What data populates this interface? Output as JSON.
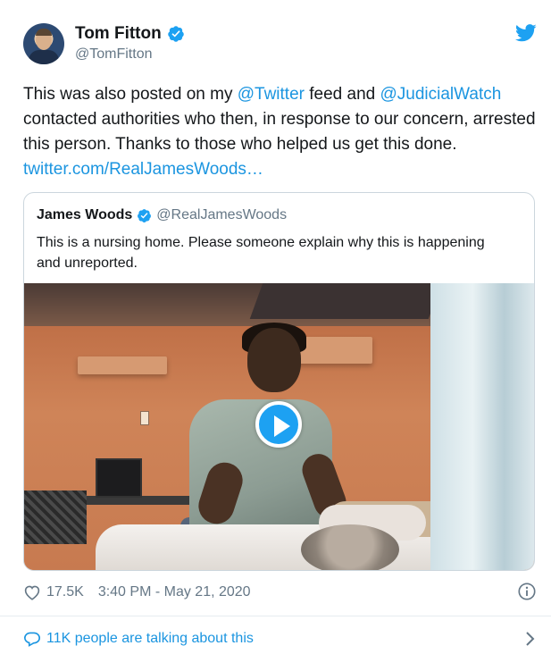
{
  "author": {
    "display_name": "Tom Fitton",
    "handle": "@TomFitton",
    "verified": true
  },
  "tweet": {
    "segments": [
      {
        "text": "This was also posted on my ",
        "link": false
      },
      {
        "text": "@Twitter",
        "link": true
      },
      {
        "text": " feed and ",
        "link": false
      },
      {
        "text": "@JudicialWatch",
        "link": true
      },
      {
        "text": " contacted authorities who then, in response to our concern, arrested this person. Thanks to those who helped us get this done. ",
        "link": false
      },
      {
        "text": "twitter.com/RealJamesWoods…",
        "link": true
      }
    ]
  },
  "quoted_tweet": {
    "display_name": "James Woods",
    "handle": "@RealJamesWoods",
    "verified": true,
    "text": "This is a nursing home. Please someone explain why this is happening and unreported."
  },
  "footer": {
    "likes": "17.5K",
    "timestamp": "3:40 PM - May 21, 2020",
    "talking": "11K people are talking about this"
  },
  "icons": {
    "verified": "verified-badge-icon",
    "brand": "twitter-bird-icon",
    "like": "heart-icon",
    "info": "info-icon",
    "reply": "speech-bubble-icon",
    "chevron": "chevron-right-icon",
    "play": "play-icon"
  },
  "colors": {
    "link": "#1b95e0",
    "brand": "#1da1f2",
    "muted": "#657786",
    "text": "#14171a",
    "border": "#ccd6dd"
  }
}
